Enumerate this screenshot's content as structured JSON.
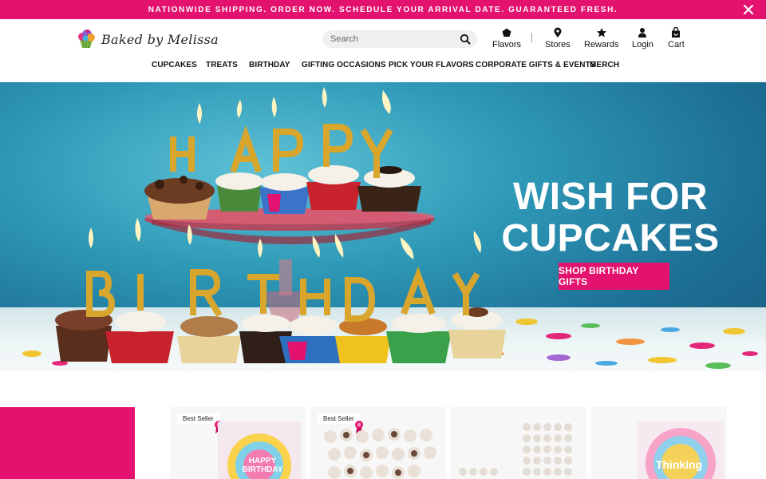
{
  "promo": {
    "text": "NATIONWIDE SHIPPING. ORDER NOW. SCHEDULE YOUR ARRIVAL DATE. GUARANTEED FRESH.",
    "bg_color": "#e3126e",
    "close_icon": "close-icon"
  },
  "header": {
    "logo_text": "Baked by Melissa",
    "search": {
      "placeholder": "Search",
      "value": ""
    },
    "utility": [
      {
        "label": "Flavors",
        "icon": "pentagon-icon"
      },
      {
        "label": "Stores",
        "icon": "map-pin-icon"
      },
      {
        "label": "Rewards",
        "icon": "star-icon"
      },
      {
        "label": "Login",
        "icon": "user-icon"
      },
      {
        "label": "Cart",
        "icon": "bag-icon"
      }
    ],
    "nav": [
      "CUPCAKES",
      "TREATS",
      "BIRTHDAY",
      "GIFTING OCCASIONS",
      "PICK YOUR FLAVORS",
      "CORPORATE GIFTS & EVENTS",
      "MERCH"
    ]
  },
  "hero": {
    "headline_line1": "WISH FOR",
    "headline_line2": "CUPCAKES",
    "cta": "SHOP BIRTHDAY GIFTS",
    "candles_top": [
      "H",
      "A",
      "P",
      "P",
      "Y"
    ],
    "candles_bottom": [
      "B",
      "I",
      "R",
      "T",
      "H",
      "D",
      "A",
      "Y"
    ]
  },
  "products": [
    {
      "badge": "Best Seller",
      "box_text": "HAPPY BIRTHDAY"
    },
    {
      "badge": "Best Seller",
      "box_text": ""
    },
    {
      "badge": "",
      "box_text": ""
    },
    {
      "badge": "",
      "box_text": "Thinking"
    }
  ],
  "colors": {
    "brand_pink": "#e3126e",
    "hero_blue": "#2f9ab8",
    "gold": "#e2b33c"
  }
}
